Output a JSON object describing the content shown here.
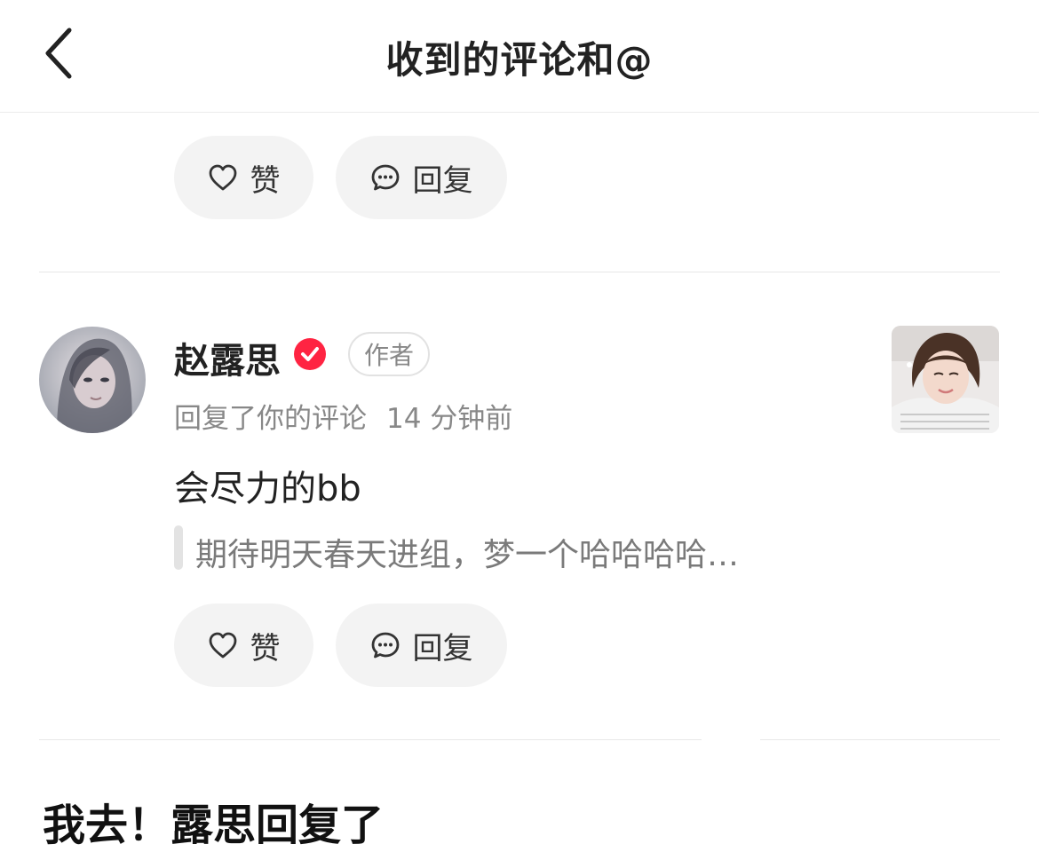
{
  "header": {
    "title": "收到的评论和@"
  },
  "first_item": {
    "like_label": "赞",
    "reply_label": "回复"
  },
  "notification": {
    "user_name": "赵露思",
    "author_tag": "作者",
    "action": "回复了你的评论",
    "time": "14 分钟前",
    "comment": "会尽力的bb",
    "quoted": "期待明天春天进组，梦一个哈哈哈哈…",
    "like_label": "赞",
    "reply_label": "回复"
  },
  "caption": {
    "text": "我去！露思回复了"
  },
  "colors": {
    "verified": "#ff2442",
    "pill_bg": "#f3f3f3",
    "muted_text": "#888888"
  },
  "icons": [
    "back-arrow-icon",
    "heart-icon",
    "comment-bubble-icon",
    "verified-check-icon"
  ]
}
